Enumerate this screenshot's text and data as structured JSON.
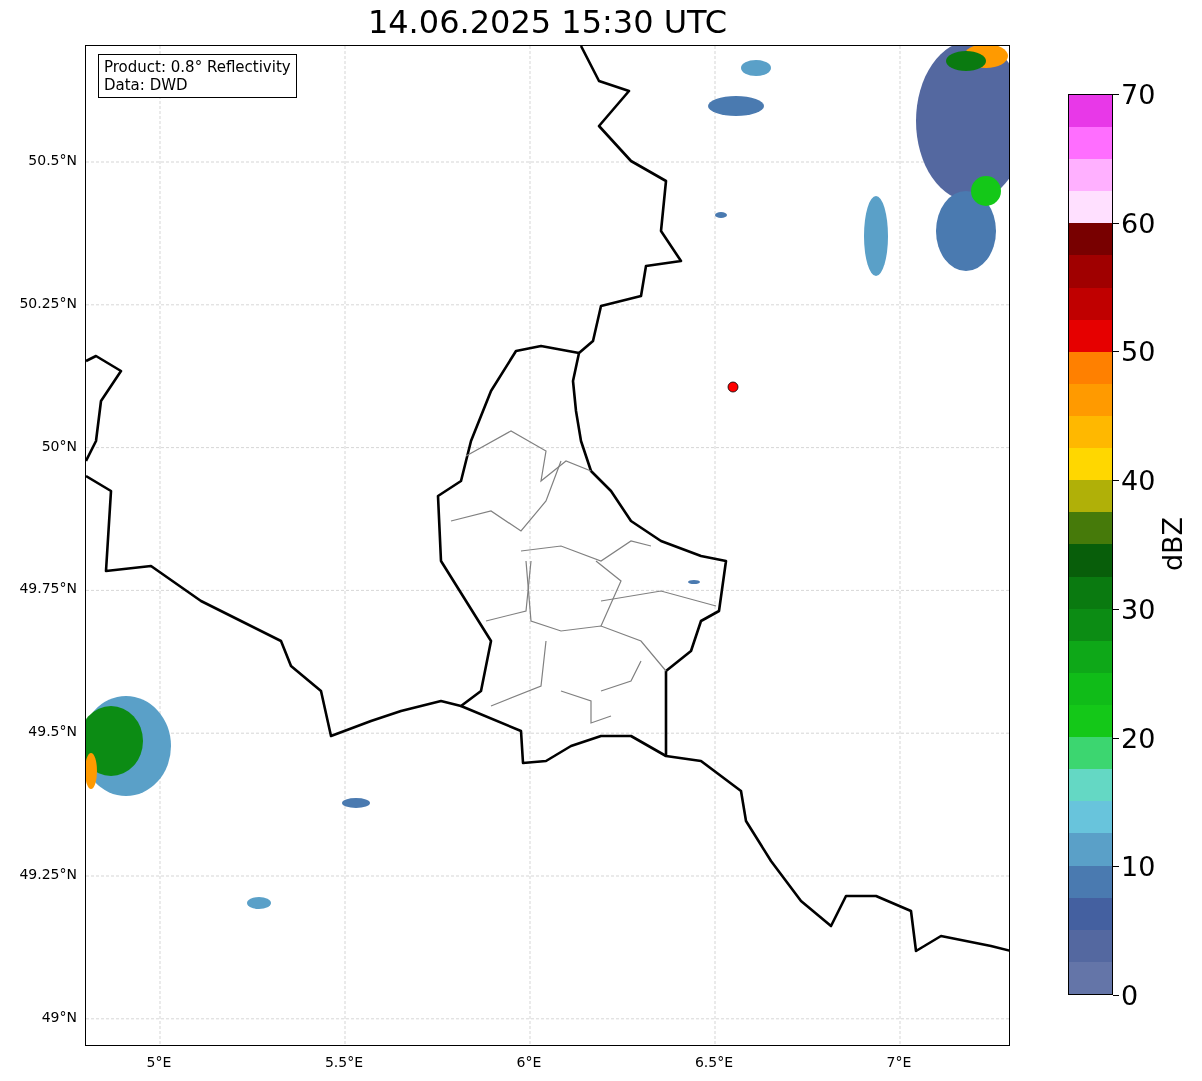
{
  "title": "14.06.2025 15:30 UTC",
  "info_box": {
    "lines": [
      "Product: 0.8° Reflectivity",
      "Data: DWD"
    ]
  },
  "map": {
    "lat_ticks": [
      "50.5°N",
      "50.25°N",
      "50°N",
      "49.75°N",
      "49.5°N",
      "49.25°N",
      "49°N"
    ],
    "lon_ticks": [
      "5°E",
      "5.5°E",
      "6°E",
      "6.5°E",
      "7°E"
    ]
  },
  "colorbar": {
    "label": "dBZ",
    "ticks": [
      "70",
      "60",
      "50",
      "40",
      "30",
      "20",
      "10",
      "0"
    ],
    "segments": [
      {
        "color": "#6475a8"
      },
      {
        "color": "#5468a0"
      },
      {
        "color": "#4460a0"
      },
      {
        "color": "#4a7ab0"
      },
      {
        "color": "#5aa0c8"
      },
      {
        "color": "#68c4dc"
      },
      {
        "color": "#64d8c4"
      },
      {
        "color": "#3cd670"
      },
      {
        "color": "#14c818"
      },
      {
        "color": "#10bc18"
      },
      {
        "color": "#0ea818"
      },
      {
        "color": "#0c8c14"
      },
      {
        "color": "#0a7a10"
      },
      {
        "color": "#085e0a"
      },
      {
        "color": "#467a0a"
      },
      {
        "color": "#b0b008"
      },
      {
        "color": "#ffd700"
      },
      {
        "color": "#ffb800"
      },
      {
        "color": "#ff9a00"
      },
      {
        "color": "#ff8000"
      },
      {
        "color": "#e60000"
      },
      {
        "color": "#c00000"
      },
      {
        "color": "#a00000"
      },
      {
        "color": "#780000"
      },
      {
        "color": "#ffe0ff"
      },
      {
        "color": "#ffb0ff"
      },
      {
        "color": "#ff6eff"
      },
      {
        "color": "#e838e8"
      }
    ]
  }
}
